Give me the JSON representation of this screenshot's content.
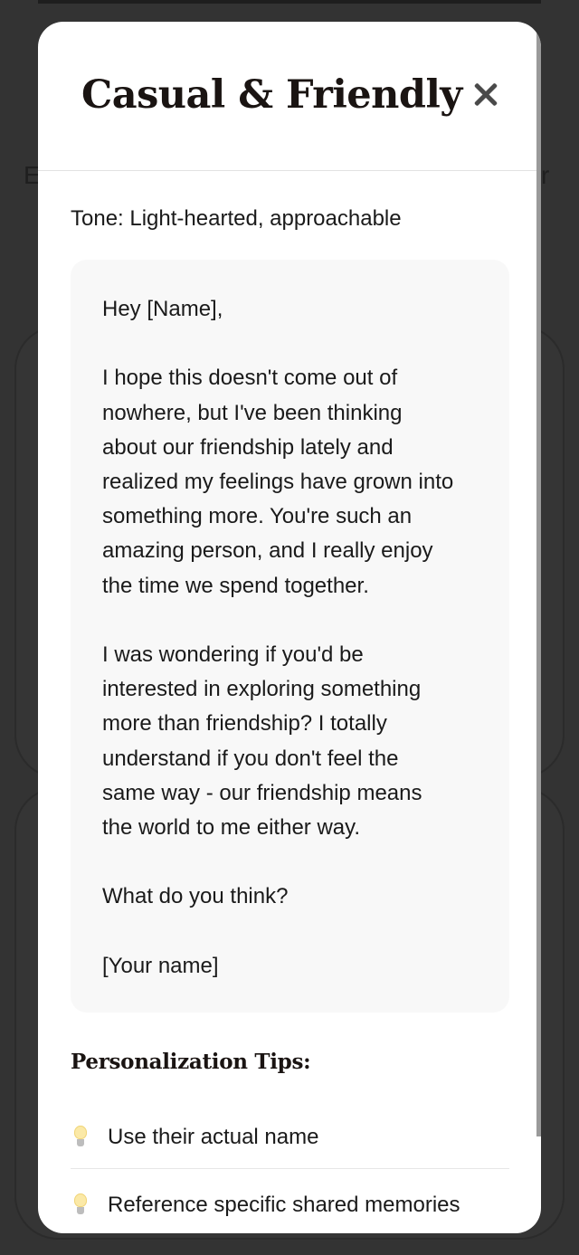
{
  "background": {
    "left_fragment": "E",
    "right_fragment": "r"
  },
  "modal": {
    "title": "Casual & Friendly",
    "close_icon": "close-icon",
    "tone": "Tone: Light-hearted, approachable",
    "message_paragraphs": [
      "Hey [Name],",
      "I hope this doesn't come out of\nnowhere, but I've been thinking\nabout our friendship lately and\nrealized my feelings have grown into\nsomething more. You're such an\namazing person, and I really enjoy\nthe time we spend together.",
      "I was wondering if you'd be\ninterested in exploring something\nmore than friendship? I totally\nunderstand if you don't feel the\nsame way - our friendship means\nthe world to me either way.",
      "What do you think?",
      "[Your name]"
    ],
    "tips_heading": "Personalization Tips:",
    "tips": [
      {
        "icon": "light-bulb-icon",
        "text": "Use their actual name"
      },
      {
        "icon": "light-bulb-icon",
        "text": "Reference specific shared memories"
      }
    ]
  },
  "colors": {
    "backdrop": "#333333",
    "modal": "#ffffff",
    "message_box": "#f8f8f8",
    "text": "#1a1a1a"
  }
}
